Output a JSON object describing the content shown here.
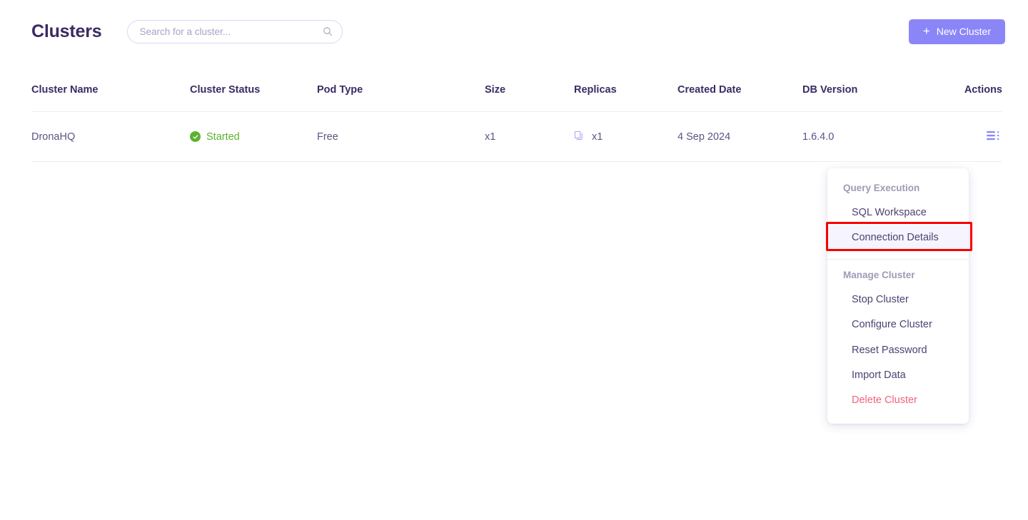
{
  "header": {
    "title": "Clusters",
    "search": {
      "placeholder": "Search for a cluster...",
      "value": "",
      "icon": "search-icon"
    },
    "new_cluster_button": {
      "label": "New Cluster",
      "plus": "+",
      "bg_color": "#8b86f7",
      "text_color": "#ffffff"
    }
  },
  "table": {
    "columns": [
      "Cluster Name",
      "Cluster Status",
      "Pod Type",
      "Size",
      "Replicas",
      "Created Date",
      "DB Version",
      "Actions"
    ],
    "rows": [
      {
        "cluster_name": "DronaHQ",
        "cluster_status": "Started",
        "status_color": "#5cb130",
        "status_icon": "check-circle-icon",
        "pod_type": "Free",
        "size": "x1",
        "replicas": "x1",
        "replicas_icon": "copy-icon",
        "created_date": "4 Sep 2024",
        "db_version": "1.6.4.0",
        "actions_icon": "list-menu-icon"
      }
    ]
  },
  "dropdown": {
    "sections": [
      {
        "label": "Query Execution",
        "items": [
          {
            "label": "SQL Workspace",
            "danger": false,
            "highlighted": false
          },
          {
            "label": "Connection Details",
            "danger": false,
            "highlighted": true
          }
        ]
      },
      {
        "label": "Manage Cluster",
        "items": [
          {
            "label": "Stop Cluster",
            "danger": false,
            "highlighted": false
          },
          {
            "label": "Configure Cluster",
            "danger": false,
            "highlighted": false
          },
          {
            "label": "Reset Password",
            "danger": false,
            "highlighted": false
          },
          {
            "label": "Import Data",
            "danger": false,
            "highlighted": false
          },
          {
            "label": "Delete Cluster",
            "danger": true,
            "highlighted": false
          }
        ]
      }
    ],
    "highlight_color": "#f80000",
    "danger_color": "#f2637e"
  }
}
